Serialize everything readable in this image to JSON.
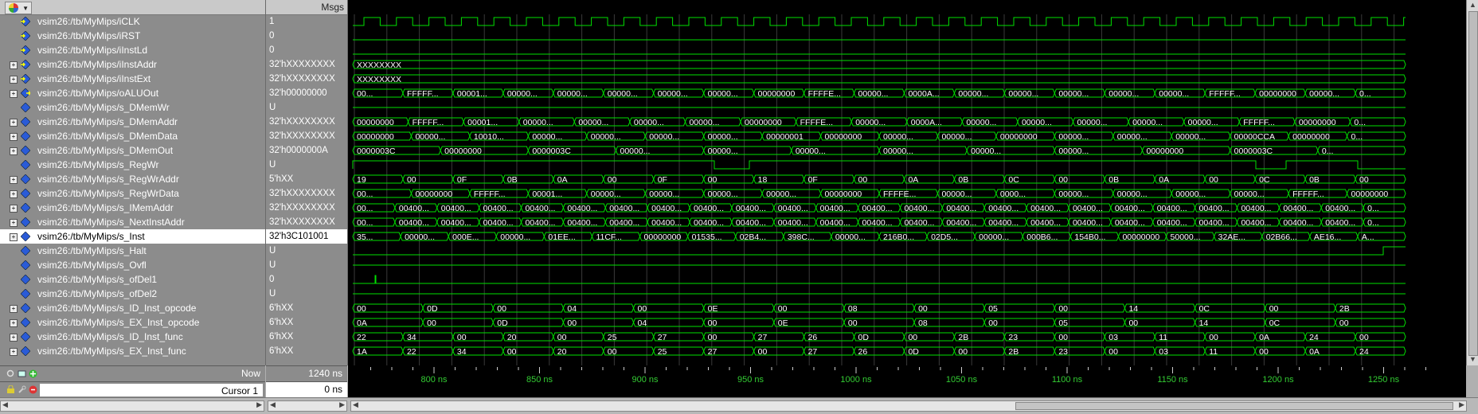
{
  "header": {
    "msgs_label": "Msgs"
  },
  "signals": [
    {
      "name": "vsim26:/tb/MyMips/iCLK",
      "value": "1",
      "expandable": false,
      "icon": "input-icon"
    },
    {
      "name": "vsim26:/tb/MyMips/iRST",
      "value": "0",
      "expandable": false,
      "icon": "input-icon"
    },
    {
      "name": "vsim26:/tb/MyMips/iInstLd",
      "value": "0",
      "expandable": false,
      "icon": "input-icon"
    },
    {
      "name": "vsim26:/tb/MyMips/iInstAddr",
      "value": "32'hXXXXXXXX",
      "expandable": true,
      "icon": "input-icon"
    },
    {
      "name": "vsim26:/tb/MyMips/iInstExt",
      "value": "32'hXXXXXXXX",
      "expandable": true,
      "icon": "input-icon"
    },
    {
      "name": "vsim26:/tb/MyMips/oALUOut",
      "value": "32'h00000000",
      "expandable": true,
      "icon": "output-icon"
    },
    {
      "name": "vsim26:/tb/MyMips/s_DMemWr",
      "value": "U",
      "expandable": false,
      "icon": "signal-icon"
    },
    {
      "name": "vsim26:/tb/MyMips/s_DMemAddr",
      "value": "32'hXXXXXXXX",
      "expandable": true,
      "icon": "signal-icon"
    },
    {
      "name": "vsim26:/tb/MyMips/s_DMemData",
      "value": "32'hXXXXXXXX",
      "expandable": true,
      "icon": "signal-icon"
    },
    {
      "name": "vsim26:/tb/MyMips/s_DMemOut",
      "value": "32'h0000000A",
      "expandable": true,
      "icon": "signal-icon"
    },
    {
      "name": "vsim26:/tb/MyMips/s_RegWr",
      "value": "U",
      "expandable": false,
      "icon": "signal-icon"
    },
    {
      "name": "vsim26:/tb/MyMips/s_RegWrAddr",
      "value": "5'hXX",
      "expandable": true,
      "icon": "signal-icon"
    },
    {
      "name": "vsim26:/tb/MyMips/s_RegWrData",
      "value": "32'hXXXXXXXX",
      "expandable": true,
      "icon": "signal-icon"
    },
    {
      "name": "vsim26:/tb/MyMips/s_IMemAddr",
      "value": "32'hXXXXXXXX",
      "expandable": true,
      "icon": "signal-icon"
    },
    {
      "name": "vsim26:/tb/MyMips/s_NextInstAddr",
      "value": "32'hXXXXXXXX",
      "expandable": true,
      "icon": "signal-icon"
    },
    {
      "name": "vsim26:/tb/MyMips/s_Inst",
      "value": "32'h3C101001",
      "expandable": true,
      "icon": "signal-icon",
      "selected": true
    },
    {
      "name": "vsim26:/tb/MyMips/s_Halt",
      "value": "U",
      "expandable": false,
      "icon": "signal-icon"
    },
    {
      "name": "vsim26:/tb/MyMips/s_Ovfl",
      "value": "U",
      "expandable": false,
      "icon": "signal-icon"
    },
    {
      "name": "vsim26:/tb/MyMips/s_ofDel1",
      "value": "0",
      "expandable": false,
      "icon": "signal-icon"
    },
    {
      "name": "vsim26:/tb/MyMips/s_ofDel2",
      "value": "U",
      "expandable": false,
      "icon": "signal-icon"
    },
    {
      "name": "vsim26:/tb/MyMips/s_ID_Inst_opcode",
      "value": "6'hXX",
      "expandable": true,
      "icon": "signal-icon"
    },
    {
      "name": "vsim26:/tb/MyMips/s_EX_Inst_opcode",
      "value": "6'hXX",
      "expandable": true,
      "icon": "signal-icon"
    },
    {
      "name": "vsim26:/tb/MyMips/s_ID_Inst_func",
      "value": "6'hXX",
      "expandable": true,
      "icon": "signal-icon"
    },
    {
      "name": "vsim26:/tb/MyMips/s_EX_Inst_func",
      "value": "6'hXX",
      "expandable": true,
      "icon": "signal-icon"
    }
  ],
  "bus_labels": [
    [],
    [],
    [],
    [
      "XXXXXXXX"
    ],
    [
      "XXXXXXXX"
    ],
    [
      "00...",
      "FFFFF...",
      "00001...",
      "00000...",
      "00000...",
      "00000...",
      "00000...",
      "00000...",
      "00000000",
      "FFFFE...",
      "00000...",
      "0000A...",
      "00000...",
      "00000...",
      "00000...",
      "00000...",
      "00000...",
      "FFFFF...",
      "00000000",
      "00000...",
      "0..."
    ],
    [],
    [
      "00000000",
      "FFFFF...",
      "00001...",
      "00000...",
      "00000...",
      "00000...",
      "00000...",
      "00000000",
      "FFFFE...",
      "00000...",
      "0000A...",
      "00000...",
      "00000...",
      "00000...",
      "00000...",
      "00000...",
      "FFFFF...",
      "00000000",
      "0..."
    ],
    [
      "00000000",
      "00000...",
      "10010...",
      "00000...",
      "00000...",
      "00000...",
      "00000...",
      "00000001",
      "00000000",
      "00000...",
      "00000...",
      "00000000",
      "00000...",
      "00000...",
      "00000...",
      "00000CCA",
      "00000000",
      "0..."
    ],
    [
      "0000003C",
      "00000000",
      "0000003C",
      "00000...",
      "00000...",
      "00000...",
      "00000...",
      "00000...",
      "00000...",
      "00000000",
      "0000003C",
      "0..."
    ],
    [],
    [
      "19",
      "00",
      "0F",
      "0B",
      "0A",
      "00",
      "0F",
      "00",
      "18",
      "0F",
      "00",
      "0A",
      "0B",
      "0C",
      "00",
      "0B",
      "0A",
      "00",
      "0C",
      "0B",
      "00"
    ],
    [
      "00...",
      "00000000",
      "FFFFF...",
      "00001...",
      "00000...",
      "00000...",
      "00000...",
      "00000...",
      "00000000",
      "FFFFE...",
      "00000...",
      "0000...",
      "00000...",
      "00000...",
      "00000...",
      "00000...",
      "FFFFF...",
      "00000000"
    ],
    [
      "00...",
      "00400...",
      "00400...",
      "00400...",
      "00400...",
      "00400...",
      "00400...",
      "00400...",
      "00400...",
      "00400...",
      "00400...",
      "00400...",
      "00400...",
      "00400...",
      "00400...",
      "00400...",
      "00400...",
      "00400...",
      "00400...",
      "00400...",
      "00400...",
      "00400...",
      "00400...",
      "00400...",
      "0..."
    ],
    [
      "00...",
      "00400...",
      "00400...",
      "00400...",
      "00400...",
      "00400...",
      "00400...",
      "00400...",
      "00400...",
      "00400...",
      "00400...",
      "00400...",
      "00400...",
      "00400...",
      "00400...",
      "00400...",
      "00400...",
      "00400...",
      "00400...",
      "00400...",
      "00400...",
      "00400...",
      "00400...",
      "00400...",
      "0..."
    ],
    [
      "35...",
      "00000...",
      "000E...",
      "00000...",
      "01EE...",
      "11CF...",
      "00000000",
      "01535...",
      "02B4...",
      "398C...",
      "00000...",
      "216B0...",
      "02D5...",
      "00000...",
      "000B6...",
      "154B0...",
      "00000000",
      "50000...",
      "32AE...",
      "02B66...",
      "AE16...",
      "A..."
    ],
    [],
    [],
    [],
    [],
    [
      "00",
      "0D",
      "00",
      "04",
      "00",
      "0E",
      "00",
      "08",
      "00",
      "05",
      "00",
      "14",
      "0C",
      "00",
      "2B"
    ],
    [
      "0A",
      "00",
      "0D",
      "00",
      "04",
      "00",
      "0E",
      "00",
      "08",
      "00",
      "05",
      "00",
      "14",
      "0C",
      "00"
    ],
    [
      "22",
      "34",
      "00",
      "20",
      "00",
      "25",
      "27",
      "00",
      "27",
      "26",
      "0D",
      "00",
      "2B",
      "23",
      "00",
      "03",
      "11",
      "00",
      "0A",
      "24",
      "00"
    ],
    [
      "1A",
      "22",
      "34",
      "00",
      "20",
      "00",
      "25",
      "27",
      "00",
      "27",
      "26",
      "0D",
      "00",
      "2B",
      "23",
      "00",
      "03",
      "11",
      "00",
      "0A",
      "24"
    ]
  ],
  "bottom": {
    "now_label": "Now",
    "now_value": "1240 ns",
    "cursor_label": "Cursor 1",
    "cursor_value": "0 ns"
  },
  "timeline": {
    "ticks": [
      "800 ns",
      "850 ns",
      "900 ns",
      "950 ns",
      "1000 ns",
      "1050 ns",
      "1100 ns",
      "1150 ns",
      "1200 ns",
      "1250 ns"
    ],
    "tick_values_ns": [
      800,
      850,
      900,
      950,
      1000,
      1050,
      1100,
      1150,
      1200,
      1250
    ]
  },
  "colors": {
    "trace": "#00e000",
    "label": "#ffffff",
    "bg": "#000000",
    "select": "#ffffff"
  }
}
